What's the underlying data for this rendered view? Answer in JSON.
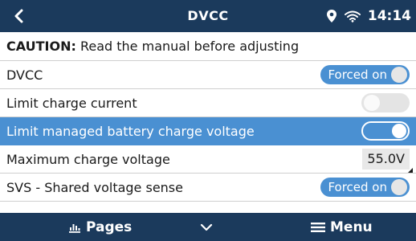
{
  "topbar": {
    "title": "DVCC",
    "time": "14:14",
    "icons": [
      "back-arrow-icon",
      "location-pin-icon",
      "wifi-icon"
    ]
  },
  "rows": {
    "caution": {
      "strong": "CAUTION:",
      "text": " Read the manual before adjusting"
    },
    "dvcc": {
      "label": "DVCC",
      "value": "Forced on"
    },
    "limit_charge_current": {
      "label": "Limit charge current",
      "state": "off"
    },
    "limit_managed_voltage": {
      "label": "Limit managed battery charge voltage",
      "state": "on",
      "selected": true
    },
    "max_charge_voltage": {
      "label": "Maximum charge voltage",
      "value": "55.0V"
    },
    "svs": {
      "label": "SVS - Shared voltage sense",
      "value": "Forced on"
    }
  },
  "bottombar": {
    "pages_label": "Pages",
    "menu_label": "Menu",
    "icons": [
      "pages-chart-icon",
      "chevron-down-icon",
      "menu-hamburger-icon"
    ]
  },
  "colors": {
    "header": "#1b3a5c",
    "accent": "#4a90d2",
    "text": "#1a1a1a"
  }
}
